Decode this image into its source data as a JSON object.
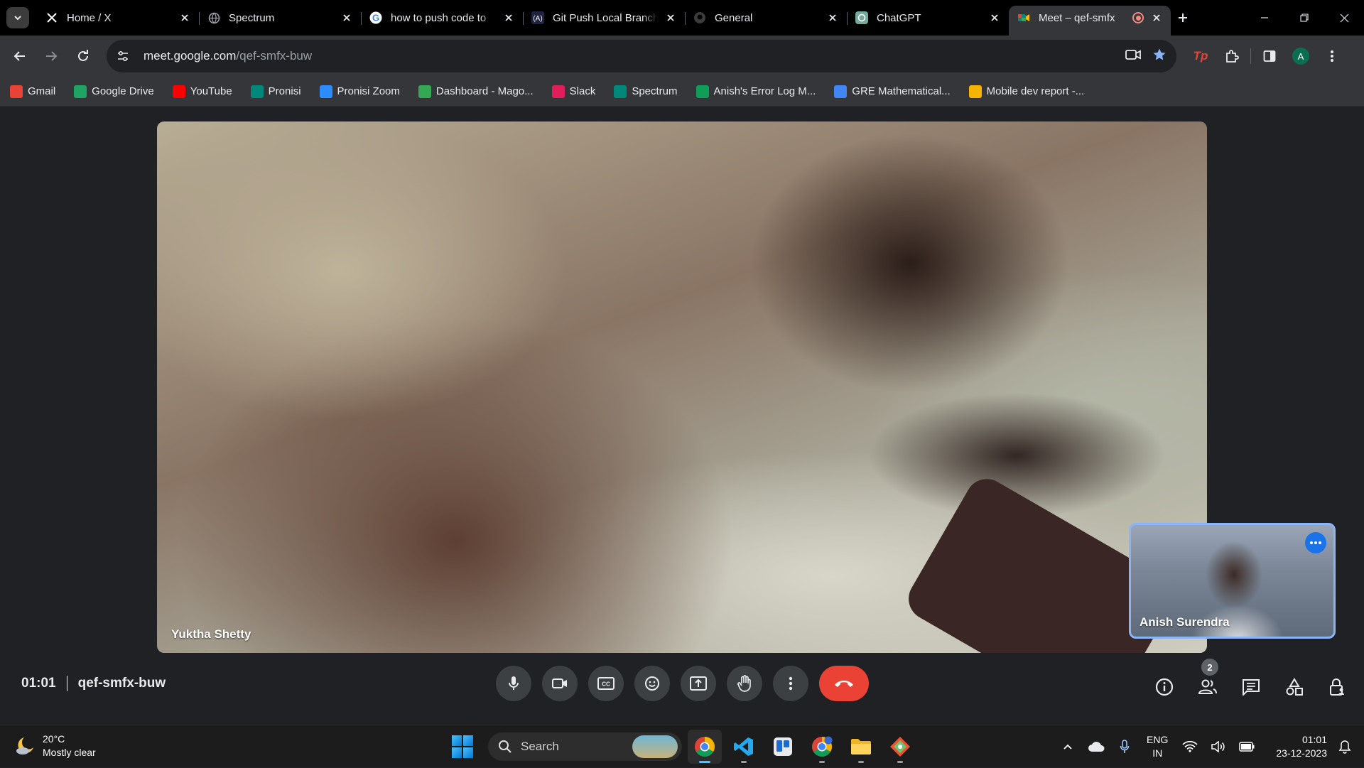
{
  "browser": {
    "tabs": [
      {
        "title": "Home / X",
        "favicon": "x-logo-icon"
      },
      {
        "title": "Spectrum",
        "favicon": "globe-icon"
      },
      {
        "title": "how to push code to",
        "favicon": "google-icon"
      },
      {
        "title": "Git Push Local Branch",
        "favicon": "phind-icon"
      },
      {
        "title": "General",
        "favicon": "github-icon"
      },
      {
        "title": "ChatGPT",
        "favicon": "chatgpt-icon"
      },
      {
        "title": "Meet – qef-smfx",
        "favicon": "google-meet-icon",
        "active": true,
        "recording": true
      }
    ],
    "address_bar": {
      "host": "meet.google.com",
      "path": "/qef-smfx-buw"
    },
    "bookmarks": [
      {
        "label": "Gmail",
        "icon": "gmail-icon",
        "color": "#ea4335"
      },
      {
        "label": "Google Drive",
        "icon": "drive-icon",
        "color": "#1fa463"
      },
      {
        "label": "YouTube",
        "icon": "youtube-icon",
        "color": "#ff0000"
      },
      {
        "label": "Pronisi",
        "icon": "meet-icon",
        "color": "#00897b"
      },
      {
        "label": "Pronisi Zoom",
        "icon": "zoom-icon",
        "color": "#2d8cff"
      },
      {
        "label": "Dashboard - Mago...",
        "icon": "dashboard-icon",
        "color": "#34a853"
      },
      {
        "label": "Slack",
        "icon": "slack-icon",
        "color": "#e01e5a"
      },
      {
        "label": "Spectrum",
        "icon": "meet-icon",
        "color": "#00897b"
      },
      {
        "label": "Anish's Error Log M...",
        "icon": "sheets-icon",
        "color": "#0f9d58"
      },
      {
        "label": "GRE Mathematical...",
        "icon": "loading-icon",
        "color": "#4285f4"
      },
      {
        "label": "Mobile dev report -...",
        "icon": "slides-icon",
        "color": "#f4b400"
      }
    ],
    "profile_initial": "A",
    "extension_label": "Tp"
  },
  "meet": {
    "main_participant": "Yuktha Shetty",
    "self_participant": "Anish Surendra",
    "time": "01:01",
    "meeting_code": "qef-smfx-buw",
    "participant_count": "2",
    "accent": "#8ab4f8",
    "end_call_color": "#ea4335"
  },
  "taskbar": {
    "weather": {
      "temp": "20°C",
      "condition": "Mostly clear"
    },
    "search_placeholder": "Search",
    "language": {
      "lang": "ENG",
      "region": "IN"
    },
    "clock": {
      "time": "01:01",
      "date": "23-12-2023"
    }
  }
}
